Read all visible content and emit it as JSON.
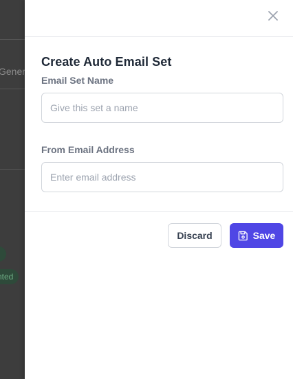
{
  "background": {
    "tab_fragment": "Gener",
    "badges": [
      "d",
      "nted"
    ]
  },
  "drawer": {
    "title": "Create Auto Email Set",
    "close_icon": "close-icon",
    "fields": [
      {
        "label": "Email Set Name",
        "value": "",
        "placeholder": "Give this set a name"
      },
      {
        "label": "From Email Address",
        "value": "",
        "placeholder": "Enter email address"
      }
    ],
    "buttons": {
      "discard_label": "Discard",
      "save_label": "Save",
      "save_icon": "floppy-disk-icon"
    }
  },
  "colors": {
    "accent": "#4f46e5",
    "backdrop": "#3d3d3d",
    "badge_text": "#6fae86"
  }
}
